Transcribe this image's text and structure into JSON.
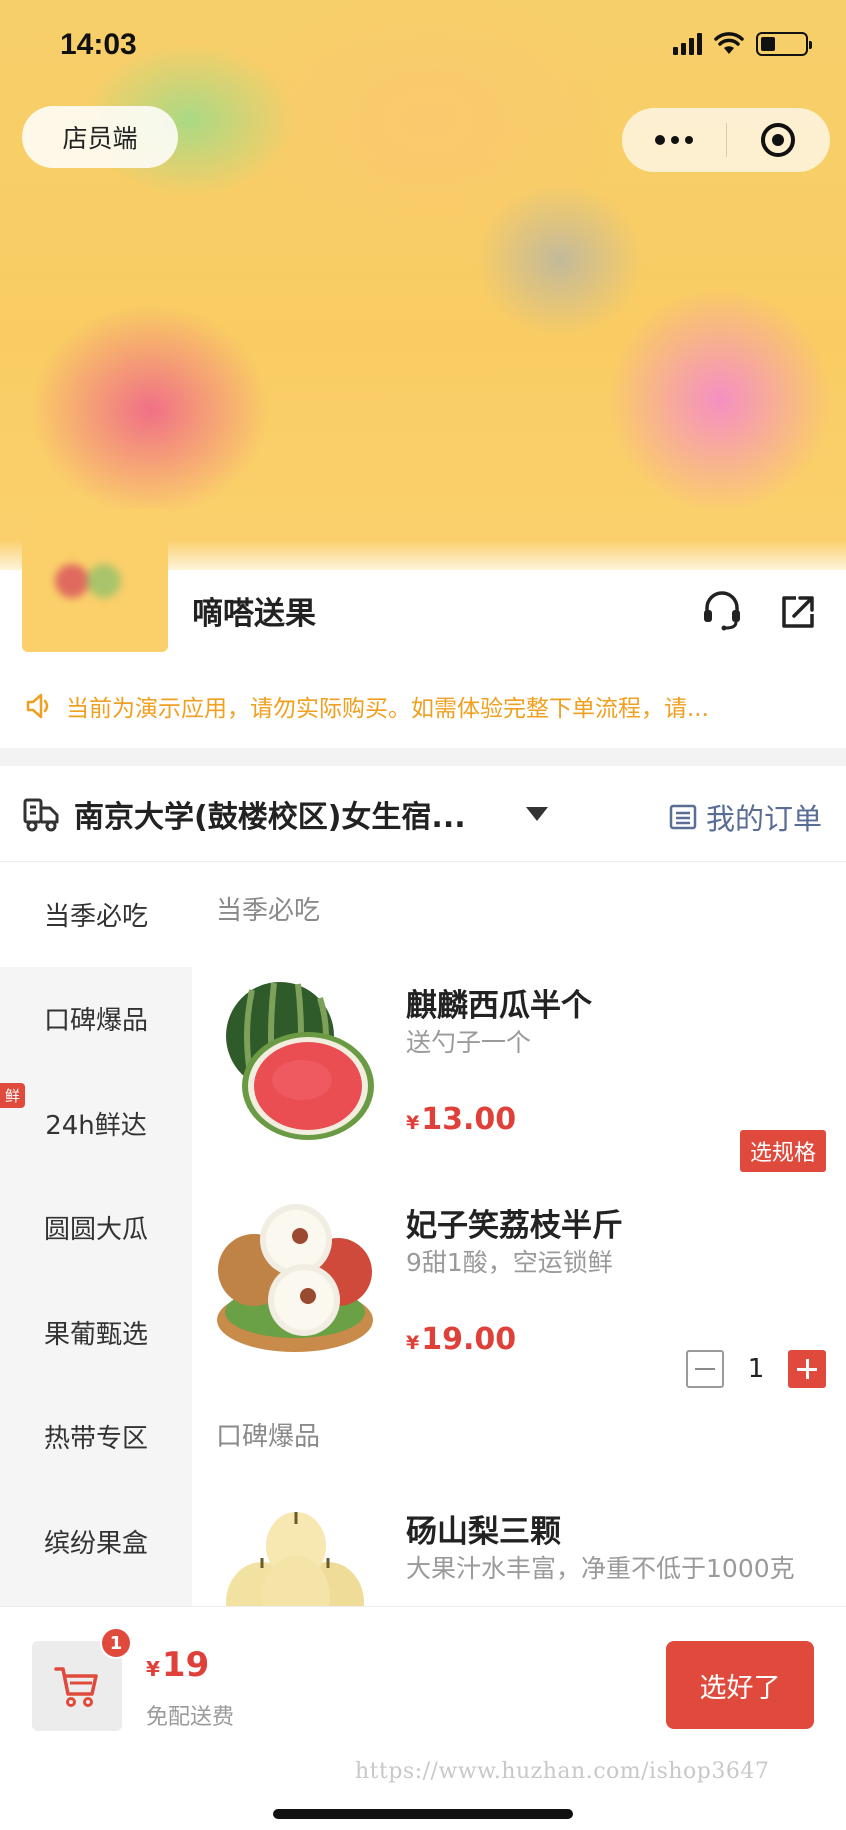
{
  "status_bar": {
    "time": "14:03"
  },
  "header": {
    "staff_label": "店员端"
  },
  "store": {
    "name": "嘀嗒送果"
  },
  "notice": {
    "text": "当前为演示应用，请勿实际购买。如需体验完整下单流程，请..."
  },
  "address": {
    "text": "南京大学(鼓楼校区)女生宿...",
    "orders_label": "我的订单"
  },
  "categories": [
    {
      "label": "当季必吃"
    },
    {
      "label": "口碑爆品"
    },
    {
      "label": "24h鲜达",
      "tag": "鲜"
    },
    {
      "label": "圆圆大瓜"
    },
    {
      "label": "果葡甄选"
    },
    {
      "label": "热带专区"
    },
    {
      "label": "缤纷果盒"
    }
  ],
  "sections": [
    {
      "title": "当季必吃"
    },
    {
      "title": "口碑爆品"
    }
  ],
  "products": [
    {
      "name": "麒麟西瓜半个",
      "desc": "送勺子一个",
      "currency": "¥",
      "price": "13.00",
      "action": "选规格"
    },
    {
      "name": "妃子笑荔枝半斤",
      "desc": "9甜1酸，空运锁鲜",
      "currency": "¥",
      "price": "19.00",
      "quantity": "1"
    },
    {
      "name": "砀山梨三颗",
      "desc": "大果汁水丰富，净重不低于1000克"
    }
  ],
  "cart": {
    "count": "1",
    "currency": "¥",
    "total": "19",
    "note": "免配送费",
    "checkout_label": "选好了"
  },
  "watermark": "https://www.huzhan.com/ishop3647",
  "colors": {
    "accent": "#e04a3c",
    "notice": "#f0a020",
    "link": "#5a6d95"
  }
}
